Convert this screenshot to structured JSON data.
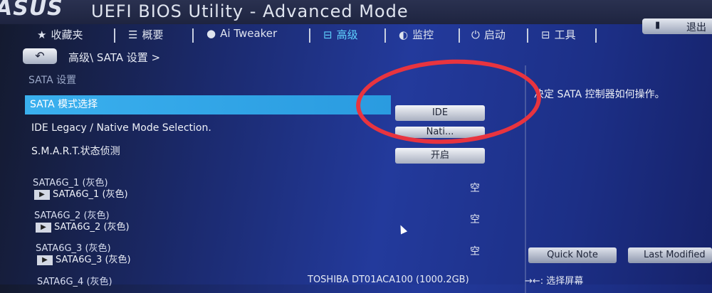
{
  "header": {
    "brand": "ASUS",
    "title": "UEFI BIOS Utility - Advanced Mode",
    "exit_label": "退出"
  },
  "menu": [
    {
      "icon": "★",
      "label": "收藏夹"
    },
    {
      "icon": "☰",
      "label": "概要"
    },
    {
      "icon": "●",
      "label": "Ai Tweaker"
    },
    {
      "icon": "⊟",
      "label": "高级"
    },
    {
      "icon": "◐",
      "label": "监控"
    },
    {
      "icon": "⏻",
      "label": "启动"
    },
    {
      "icon": "⊟",
      "label": "工具"
    }
  ],
  "breadcrumb": {
    "back_icon": "↶",
    "path": "高级\\ SATA 设置 >"
  },
  "section_title": "SATA 设置",
  "settings": [
    {
      "label": "SATA 模式选择",
      "value": "IDE"
    },
    {
      "label": "IDE Legacy / Native Mode Selection.",
      "value": "Nati..."
    },
    {
      "label": "S.M.A.R.T.状态侦测",
      "value": "开启"
    }
  ],
  "ports": [
    {
      "title": "SATA6G_1 (灰色)",
      "sub": "SATA6G_1 (灰色)",
      "value": "空"
    },
    {
      "title": "SATA6G_2 (灰色)",
      "sub": "SATA6G_2 (灰色)",
      "value": "空"
    },
    {
      "title": "SATA6G_3 (灰色)",
      "sub": "SATA6G_3 (灰色)",
      "value": "空"
    },
    {
      "title": "SATA6G_4 (灰色)",
      "value": "TOSHIBA DT01ACA100 (1000.2GB)"
    }
  ],
  "help_text": "决定 SATA 控制器如何操作。",
  "bottom_buttons": {
    "quick_note": "Quick Note",
    "last_modified": "Last Modified"
  },
  "key_hint": "→←: 选择屏幕",
  "colors": {
    "highlight": "#3ab0ee",
    "active_tab": "#5fd3ff",
    "annotation": "#e8343f"
  }
}
